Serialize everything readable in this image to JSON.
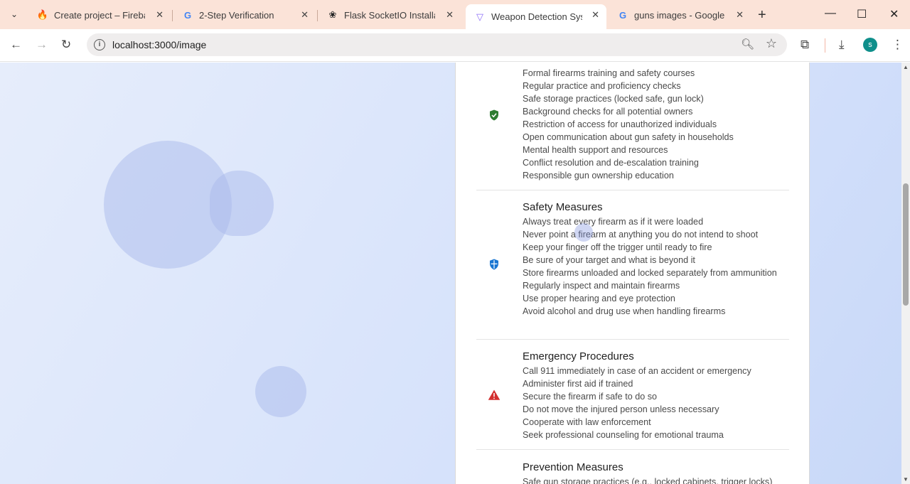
{
  "browser": {
    "tabs": [
      {
        "title": "Create project – Firebase",
        "icon": "firebase-icon"
      },
      {
        "title": "2-Step Verification",
        "icon": "google-icon"
      },
      {
        "title": "Flask SocketIO Installation",
        "icon": "openai-icon"
      },
      {
        "title": "Weapon Detection System",
        "icon": "vite-icon"
      },
      {
        "title": "guns images - Google Search",
        "icon": "google-icon"
      }
    ],
    "url": "localhost:3000/image",
    "profile_initial": "s"
  },
  "sections": [
    {
      "heading": "",
      "icon": "shield-check-icon",
      "icon_color": "#2e7d32",
      "items": [
        "Formal firearms training and safety courses",
        "Regular practice and proficiency checks",
        "Safe storage practices (locked safe, gun lock)",
        "Background checks for all potential owners",
        "Restriction of access for unauthorized individuals",
        "Open communication about gun safety in households",
        "Mental health support and resources",
        "Conflict resolution and de-escalation training",
        "Responsible gun ownership education"
      ]
    },
    {
      "heading": "Safety Measures",
      "icon": "security-shield-icon",
      "icon_color": "#1976d2",
      "items": [
        "Always treat every firearm as if it were loaded",
        "Never point a firearm at anything you do not intend to shoot",
        "Keep your finger off the trigger until ready to fire",
        "Be sure of your target and what is beyond it",
        "Store firearms unloaded and locked separately from ammunition",
        "Regularly inspect and maintain firearms",
        "Use proper hearing and eye protection",
        "Avoid alcohol and drug use when handling firearms"
      ]
    },
    {
      "heading": "Emergency Procedures",
      "icon": "warning-icon",
      "icon_color": "#d32f2f",
      "items": [
        "Call 911 immediately in case of an accident or emergency",
        "Administer first aid if trained",
        "Secure the firearm if safe to do so",
        "Do not move the injured person unless necessary",
        "Cooperate with law enforcement",
        "Seek professional counseling for emotional trauma"
      ]
    },
    {
      "heading": "Prevention Measures",
      "icon": "lock-icon",
      "icon_color": "#9e9e9e",
      "items": [
        "Safe gun storage practices (e.g., locked cabinets, trigger locks)"
      ]
    }
  ]
}
